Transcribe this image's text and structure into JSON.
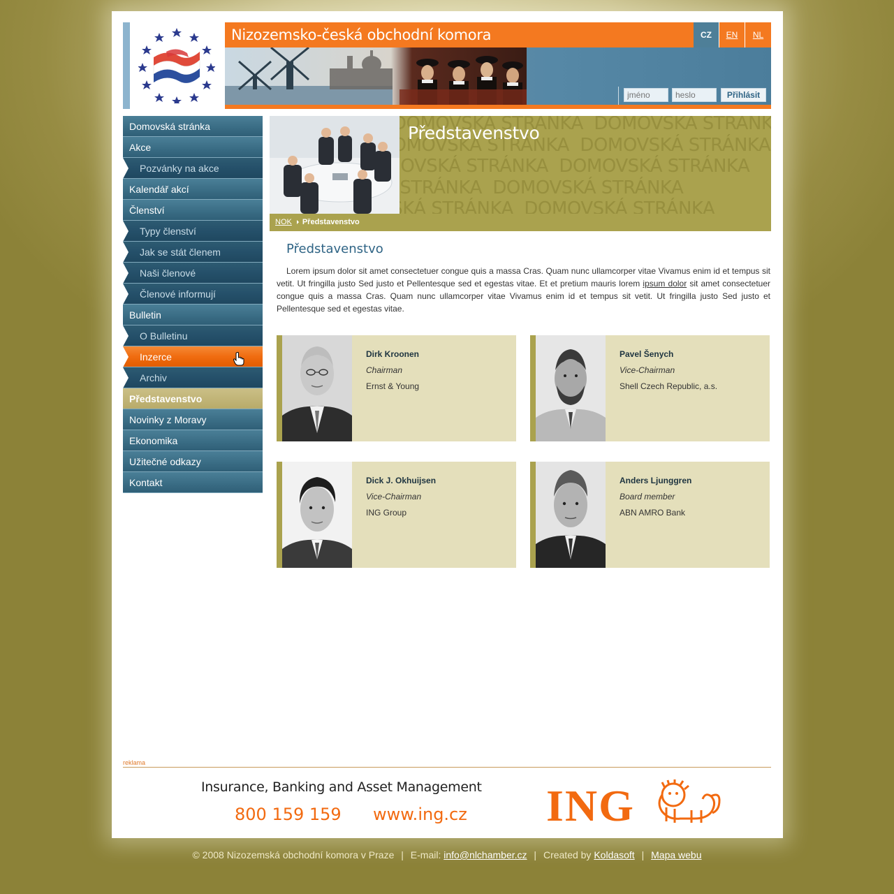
{
  "header": {
    "title": "Nizozemsko-česká obchodní komora",
    "languages": [
      "CZ",
      "EN",
      "NL"
    ],
    "login": {
      "name_placeholder": "jméno",
      "password_placeholder": "heslo",
      "button": "Přihlásit"
    }
  },
  "nav": {
    "items": [
      {
        "label": "Domovská stránka"
      },
      {
        "label": "Akce"
      },
      {
        "label": "Pozvánky na akce"
      },
      {
        "label": "Kalendář akcí"
      },
      {
        "label": "Členství"
      },
      {
        "label": "Typy členství"
      },
      {
        "label": "Jak se stát členem"
      },
      {
        "label": "Naši členové"
      },
      {
        "label": "Členové informují"
      },
      {
        "label": "Bulletin"
      },
      {
        "label": "O Bulletinu"
      },
      {
        "label": "Inzerce"
      },
      {
        "label": "Archiv"
      },
      {
        "label": "Představenstvo"
      },
      {
        "label": "Novinky z Moravy"
      },
      {
        "label": "Ekonomika"
      },
      {
        "label": "Užitečné odkazy"
      },
      {
        "label": "Kontakt"
      }
    ]
  },
  "banner": {
    "title": "Představenstvo",
    "background_text": "DOMOVSKÁ STRÁNKA"
  },
  "breadcrumb": {
    "home": "NOK",
    "current": "Představenstvo"
  },
  "content": {
    "title": "Představenstvo",
    "intro_before": "Lorem ipsum dolor sit amet consectetuer congue quis a massa Cras. Quam nunc ullamcorper vitae Vivamus enim id et tempus sit vetit. Ut fringilla justo Sed justo et Pellentesque sed et egestas vitae. Et et pretium mauris lorem ",
    "intro_link": "ipsum dolor",
    "intro_after": " sit amet consectetuer congue quis a massa Cras. Quam nunc ullamcorper vitae Vivamus enim id et tempus sit vetit. Ut fringilla justo Sed justo et Pellentesque sed et egestas vitae.",
    "members": [
      {
        "name": "Dirk Kroonen",
        "role": "Chairman",
        "company": "Ernst & Young"
      },
      {
        "name": "Pavel Šenych",
        "role": "Vice-Chairman",
        "company": "Shell Czech Republic, a.s."
      },
      {
        "name": "Dick J. Okhuijsen",
        "role": "Vice-Chairman",
        "company": "ING Group"
      },
      {
        "name": "Anders Ljunggren",
        "role": "Board member",
        "company": "ABN AMRO Bank"
      }
    ]
  },
  "ad": {
    "label": "reklama",
    "tagline": "Insurance, Banking and Asset Management",
    "phone": "800 159 159",
    "web": "www.ing.cz",
    "brand": "ING"
  },
  "footer": {
    "copyright": "© 2008 Nizozemská obchodní komora v Praze",
    "email_label": "E-mail:",
    "email": "info@nlchamber.cz",
    "created_label": "Created by",
    "creator": "Koldasoft",
    "sitemap": "Mapa webu"
  },
  "colors": {
    "orange": "#f47920",
    "blue": "#4e7f98",
    "olive": "#aaa24e",
    "member_bg": "#e4dfbb"
  }
}
